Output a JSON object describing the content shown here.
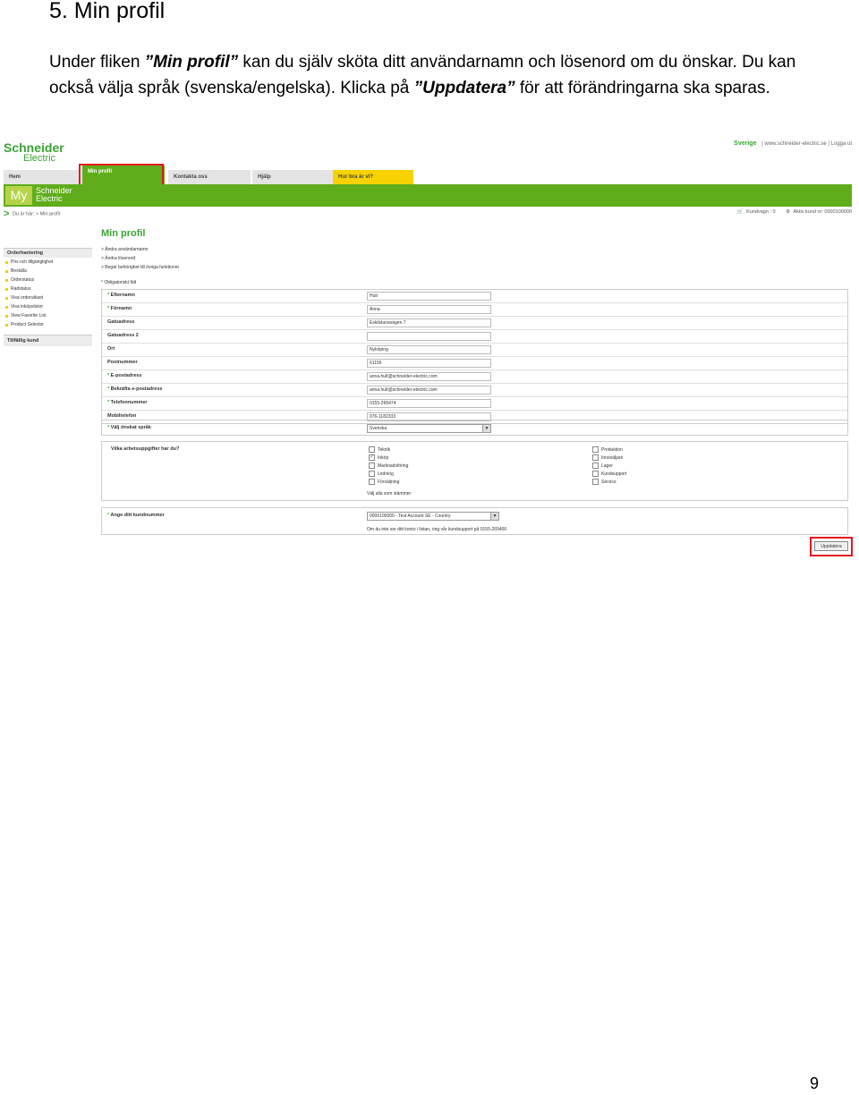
{
  "doc": {
    "heading": "5. Min profil",
    "para_pre": "Under fliken ",
    "para_tab": "”Min profil”",
    "para_mid": " kan du själv sköta ditt användarnamn och lösenord om du önskar. Du kan också välja språk (svenska/engelska). Klicka på ",
    "para_btn": "”Uppdatera”",
    "para_post": " för att förändringarna ska sparas.",
    "page_number": "9"
  },
  "screenshot": {
    "logo_top": "Schneider",
    "logo_bottom": "Electric",
    "country": "Sverige",
    "site_link": "www.schneider-electric.se",
    "separator": "|",
    "logout": "Logga ut",
    "tabs": [
      {
        "label": "Hem"
      },
      {
        "label": "Min profil"
      },
      {
        "label": "Kontakta oss"
      },
      {
        "label": "Hjälp"
      },
      {
        "label": "Hur bra är vi?"
      }
    ],
    "banner_my": "My",
    "banner_brand_1": "Schneider",
    "banner_brand_2": "Electric",
    "breadcrumb_prefix": "Du är här:",
    "breadcrumb_current": "> Min profil",
    "cart_label": "Kundvagn : 0",
    "customer_label": "Aktiv kund nr: 0000100000",
    "sidebar_head": "Orderhantering",
    "sidebar_items": [
      "Pris och tillgänglighet",
      "Beställa",
      "Orderstatus",
      "Radstatus",
      "Visa orderutkast",
      "Visa inköpslistor",
      "View Favorite List",
      "Product Selector"
    ],
    "sidebar_head2": "Tillfällig kund",
    "page_title": "Min profil",
    "links": [
      "> Ändra användarnamn",
      "> Ändra lösenord",
      "> Begär behörighet till övriga funktioner"
    ],
    "required_note": "Obligatoriskt fält",
    "fields": [
      {
        "label": "Efternamn",
        "value": "Hult",
        "req": "*"
      },
      {
        "label": "Förnamn",
        "value": "Anna",
        "req": "*"
      },
      {
        "label": "Gatuadress",
        "value": "Eskilstunavägen 7",
        "req": ""
      },
      {
        "label": "Gatuadress 2",
        "value": "",
        "req": ""
      },
      {
        "label": "Ort",
        "value": "Nyköping",
        "req": ""
      },
      {
        "label": "Postnummer",
        "value": "61156",
        "req": ""
      },
      {
        "label": "E-postadress",
        "value": "anna.hult@schneider-electric.com",
        "req": "*"
      },
      {
        "label": "Bekräfta e-postadress",
        "value": "anna.hult@schneider-electric.com",
        "req": "*"
      },
      {
        "label": "Telefonnummer",
        "value": "0155-265474",
        "req": "*"
      },
      {
        "label": "Mobiltelefon",
        "value": "076-1182333",
        "req": ""
      }
    ],
    "language_label": "Välj önskat språk",
    "language_value": "Svenska",
    "tasks_label": "Vilka arbetsuppgifter har du?",
    "tasks_left": [
      {
        "label": "Teknik",
        "checked": ""
      },
      {
        "label": "Inköp",
        "checked": "✓"
      },
      {
        "label": "Marknadsföring",
        "checked": ""
      },
      {
        "label": "Ledning",
        "checked": ""
      },
      {
        "label": "Försäljning",
        "checked": ""
      }
    ],
    "tasks_right": [
      {
        "label": "Produktion",
        "checked": ""
      },
      {
        "label": "Innesäljare",
        "checked": ""
      },
      {
        "label": "Lager",
        "checked": ""
      },
      {
        "label": "Kundsupport",
        "checked": ""
      },
      {
        "label": "Service",
        "checked": ""
      }
    ],
    "tasks_note": "Välj alla som stämmer",
    "customer_no_label": "Ange ditt kundnummer",
    "customer_no_value": "0000100000 - Test Account SE - Country",
    "customer_note": "Om du inte ser ditt konto i listan, ring vår kundsupport på 0155-265400",
    "update_button": "Uppdatera"
  }
}
